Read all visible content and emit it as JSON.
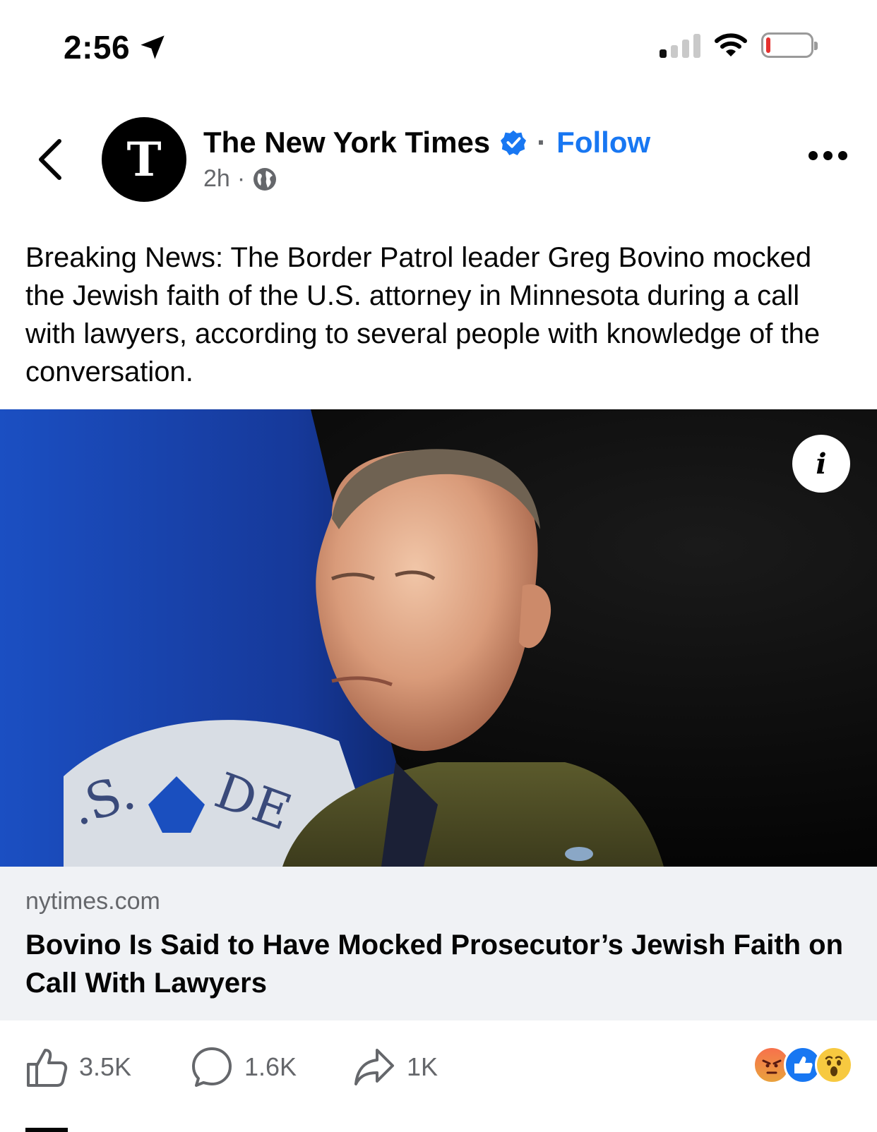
{
  "status_bar": {
    "time": "2:56",
    "location_icon": "location-arrow-icon",
    "signal_icon": "cellular-signal-icon",
    "wifi_icon": "wifi-icon",
    "battery_icon": "battery-low-icon",
    "battery_color": "#e5312f"
  },
  "post": {
    "page_name": "The New York Times",
    "follow_label": "Follow",
    "separator": "·",
    "time_ago": "2h",
    "avatar_glyph": "T",
    "text": "Breaking News: The Border Patrol leader Greg Bovino mocked the Jewish faith of the U.S. attorney in Minnesota during a call with lawyers, according to several people with knowledge of the conversation.",
    "verified_color": "#1877f2"
  },
  "photo": {
    "info_label": "i"
  },
  "link_card": {
    "domain": "nytimes.com",
    "title": "Bovino Is Said to Have Mocked Prosecutor’s Jewish Faith on Call With Lawyers"
  },
  "actions": {
    "likes": "3.5K",
    "comments": "1.6K",
    "shares": "1K"
  },
  "reactions": [
    "angry",
    "like",
    "wow"
  ]
}
